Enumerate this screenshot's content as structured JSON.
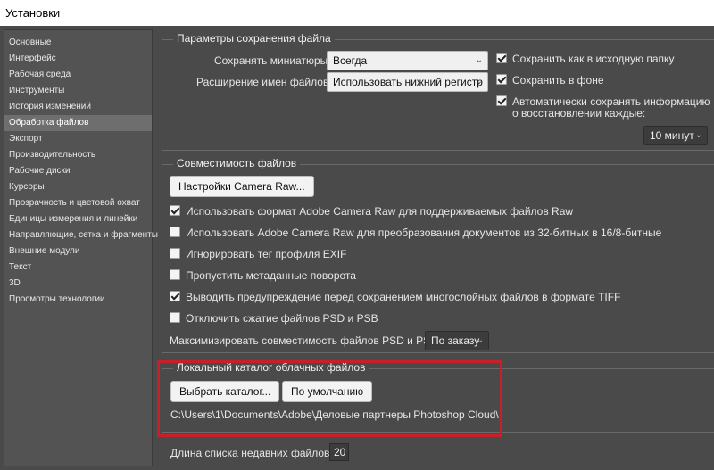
{
  "window": {
    "title": "Установки"
  },
  "sidebar": {
    "items": [
      {
        "label": "Основные"
      },
      {
        "label": "Интерфейс"
      },
      {
        "label": "Рабочая среда"
      },
      {
        "label": "Инструменты"
      },
      {
        "label": "История изменений"
      },
      {
        "label": "Обработка файлов"
      },
      {
        "label": "Экспорт"
      },
      {
        "label": "Производительность"
      },
      {
        "label": "Рабочие диски"
      },
      {
        "label": "Курсоры"
      },
      {
        "label": "Прозрачность и цветовой охват"
      },
      {
        "label": "Единицы измерения и линейки"
      },
      {
        "label": "Направляющие, сетка и фрагменты"
      },
      {
        "label": "Внешние модули"
      },
      {
        "label": "Текст"
      },
      {
        "label": "3D"
      },
      {
        "label": "Просмотры технологии"
      }
    ],
    "active_index": 5
  },
  "save_options": {
    "title": "Параметры сохранения файла",
    "thumbnails_label": "Сохранять миниатюры:",
    "thumbnails_value": "Всегда",
    "extension_label": "Расширение имен файлов:",
    "extension_value": "Использовать нижний регистр",
    "save_original_folder": {
      "label": "Сохранить как в исходную папку",
      "checked": true
    },
    "save_background": {
      "label": "Сохранить в фоне",
      "checked": true
    },
    "autosave": {
      "label_line1": "Автоматически сохранять информацию",
      "label_line2": "о восстановлении каждые:",
      "checked": true
    },
    "autosave_interval": "10 минут"
  },
  "compatibility": {
    "title": "Совместимость файлов",
    "camera_raw_button": "Настройки Camera Raw...",
    "options": [
      {
        "label": "Использовать формат Adobe Camera Raw для поддерживаемых файлов Raw",
        "checked": true
      },
      {
        "label": "Использовать Adobe Camera Raw для преобразования документов из 32-битных в 16/8-битные",
        "checked": false
      },
      {
        "label": "Игнорировать тег профиля EXIF",
        "checked": false
      },
      {
        "label": "Пропустить метаданные поворота",
        "checked": false
      },
      {
        "label": "Выводить предупреждение перед сохранением многослойных файлов в формате TIFF",
        "checked": true
      },
      {
        "label": "Отключить сжатие файлов PSD и PSB",
        "checked": false
      }
    ],
    "maximize_label": "Максимизировать совместимость файлов PSD и PSB:",
    "maximize_value": "По заказу"
  },
  "cloud": {
    "title": "Локальный каталог облачных файлов",
    "choose_button": "Выбрать каталог...",
    "default_button": "По умолчанию",
    "path": "C:\\Users\\1\\Documents\\Adobe\\Деловые партнеры Photoshop Cloud\\"
  },
  "recent": {
    "label": "Длина списка недавних файлов:",
    "value": "20"
  },
  "colors": {
    "highlight": "#c8202a",
    "panel_bg": "#4a4a4a",
    "sidebar_active": "#6e6e6e"
  }
}
